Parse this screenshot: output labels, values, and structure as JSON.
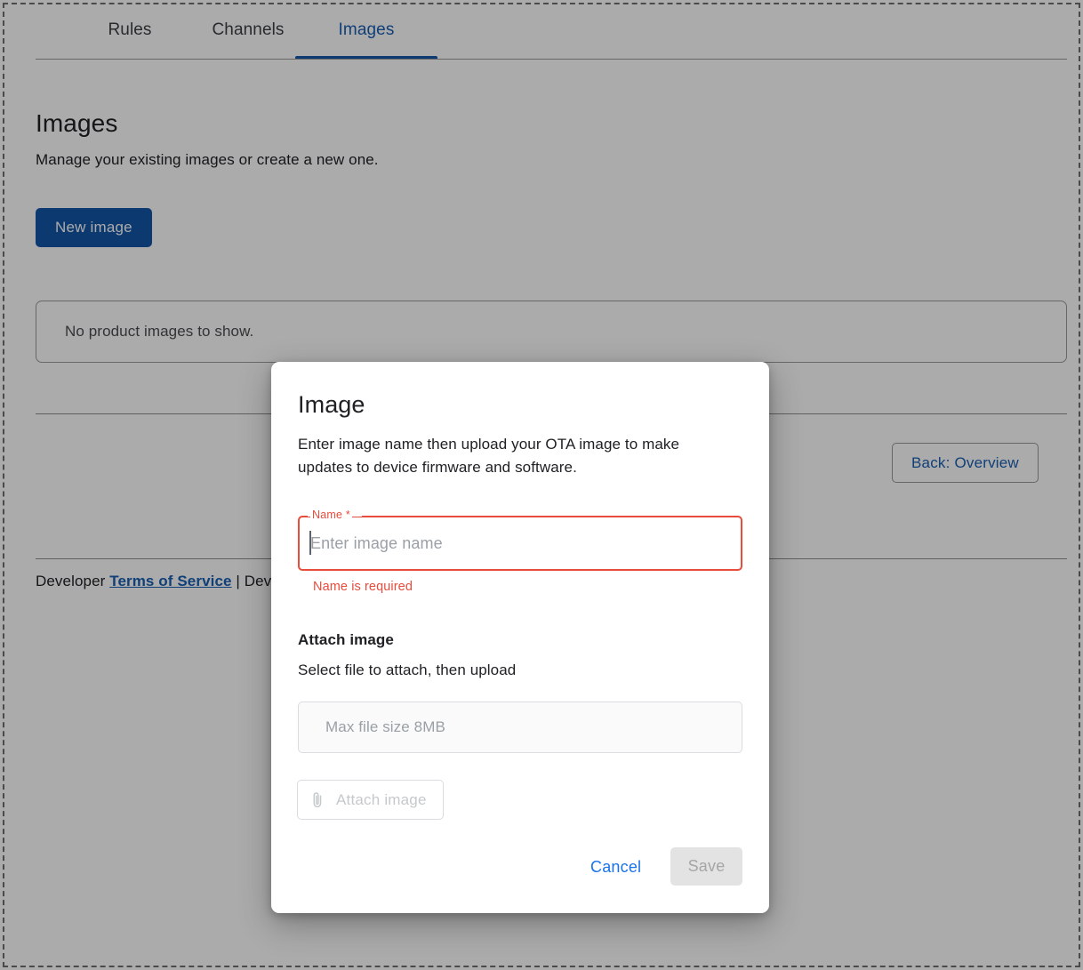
{
  "tabs": [
    {
      "label": "Rules",
      "active": false
    },
    {
      "label": "Channels",
      "active": false
    },
    {
      "label": "Images",
      "active": true
    }
  ],
  "page": {
    "title": "Images",
    "subtitle": "Manage your existing images or create a new one.",
    "new_image_label": "New image",
    "empty_state_text": "No product images to show.",
    "back_button_label": "Back: Overview"
  },
  "footer": {
    "prefix": "Developer ",
    "terms_link": "Terms of Service",
    "separator": " | ",
    "suffix": "Dev"
  },
  "dialog": {
    "title": "Image",
    "description": "Enter image name then upload your OTA image to make updates to device firmware and software.",
    "name_field": {
      "label": "Name *",
      "value": "",
      "placeholder": "Enter image name",
      "error": "Name is required"
    },
    "attach": {
      "heading": "Attach image",
      "subheading": "Select file to attach, then upload",
      "dropzone_text": "Max file size 8MB",
      "button_label": "Attach image",
      "button_icon": "paperclip-icon"
    },
    "actions": {
      "cancel_label": "Cancel",
      "save_label": "Save"
    }
  },
  "colors": {
    "accent_blue": "#1256a8",
    "link_blue": "#1a73e8",
    "error_red": "#e74c3c",
    "tab_active": "#1a5fb4",
    "disabled_gray": "#a6a6a6"
  }
}
